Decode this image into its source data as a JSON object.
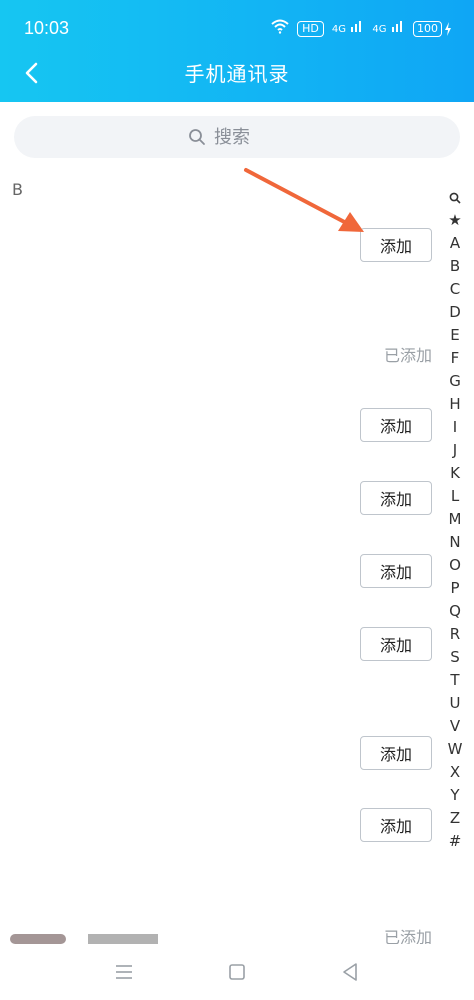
{
  "status_bar": {
    "time": "10:03",
    "wifi_icon": "wifi-icon",
    "hd_badge": "HD",
    "signal1": "4G",
    "signal2": "4G",
    "battery": "100"
  },
  "header": {
    "title": "手机通讯录",
    "back_icon": "chevron-left-icon"
  },
  "search": {
    "placeholder": "搜索"
  },
  "section": {
    "letter": "B"
  },
  "contacts": [
    {
      "status": "add",
      "label": "添加"
    },
    {
      "status": "added",
      "label": "已添加"
    },
    {
      "status": "add",
      "label": "添加"
    },
    {
      "status": "add",
      "label": "添加"
    },
    {
      "status": "add",
      "label": "添加"
    },
    {
      "status": "add",
      "label": "添加"
    },
    {
      "status": "add",
      "label": "添加"
    },
    {
      "status": "add",
      "label": "添加"
    },
    {
      "status": "added",
      "label": "已添加"
    }
  ],
  "alphabet_index": [
    "★",
    "A",
    "B",
    "C",
    "D",
    "E",
    "F",
    "G",
    "H",
    "I",
    "J",
    "K",
    "L",
    "M",
    "N",
    "O",
    "P",
    "Q",
    "R",
    "S",
    "T",
    "U",
    "V",
    "W",
    "X",
    "Y",
    "Z",
    "#"
  ],
  "colors": {
    "header_start": "#16c6f2",
    "header_end": "#0fa6f5",
    "arrow": "#f0673a"
  }
}
